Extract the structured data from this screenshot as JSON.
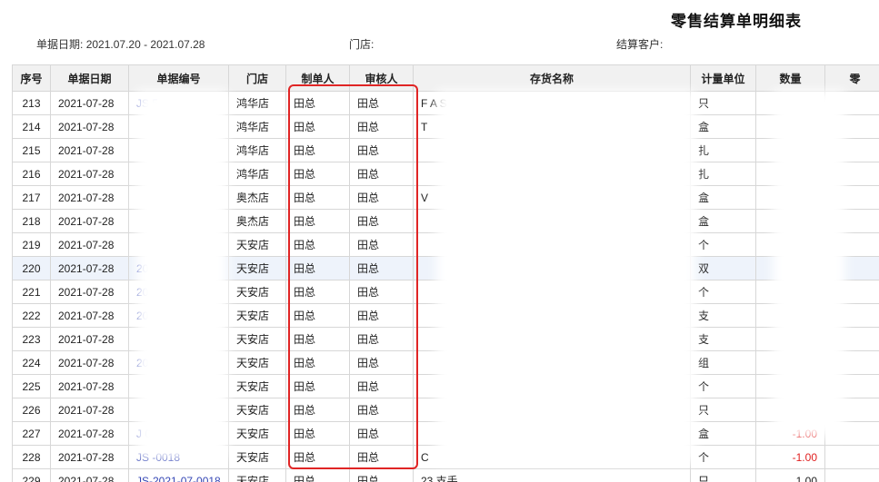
{
  "report": {
    "title": "零售结算单明细表",
    "filters": {
      "date_label": "单据日期:",
      "date_value": "2021.07.20 - 2021.07.28",
      "store_label": "门店:",
      "customer_label": "结算客户:"
    }
  },
  "table": {
    "columns": [
      "序号",
      "单据日期",
      "单据编号",
      "门店",
      "制单人",
      "审核人",
      "存货名称",
      "计量单位",
      "数量",
      "零"
    ],
    "rows": [
      {
        "seq": "213",
        "date": "2021-07-28",
        "doc_no": "JS          5",
        "store": "鸿华店",
        "maker": "田总",
        "auditor": "田总",
        "item": "F                               A S",
        "unit": "只",
        "qty": ""
      },
      {
        "seq": "214",
        "date": "2021-07-28",
        "doc_no": "",
        "store": "鸿华店",
        "maker": "田总",
        "auditor": "田总",
        "item": "T",
        "unit": "盒",
        "qty": ""
      },
      {
        "seq": "215",
        "date": "2021-07-28",
        "doc_no": "",
        "store": "鸿华店",
        "maker": "田总",
        "auditor": "田总",
        "item": "",
        "unit": "扎",
        "qty": ""
      },
      {
        "seq": "216",
        "date": "2021-07-28",
        "doc_no": "",
        "store": "鸿华店",
        "maker": "田总",
        "auditor": "田总",
        "item": "",
        "unit": "扎",
        "qty": ""
      },
      {
        "seq": "217",
        "date": "2021-07-28",
        "doc_no": "",
        "store": "奥杰店",
        "maker": "田总",
        "auditor": "田总",
        "item": "V",
        "unit": "盒",
        "qty": ""
      },
      {
        "seq": "218",
        "date": "2021-07-28",
        "doc_no": "",
        "store": "奥杰店",
        "maker": "田总",
        "auditor": "田总",
        "item": "",
        "unit": "盒",
        "qty": ""
      },
      {
        "seq": "219",
        "date": "2021-07-28",
        "doc_no": "",
        "store": "天安店",
        "maker": "田总",
        "auditor": "田总",
        "item": "",
        "unit": "个",
        "qty": ""
      },
      {
        "seq": "220",
        "date": "2021-07-28",
        "doc_no": "20",
        "store": "天安店",
        "maker": "田总",
        "auditor": "田总",
        "item": "",
        "unit": "双",
        "qty": ""
      },
      {
        "seq": "221",
        "date": "2021-07-28",
        "doc_no": "20",
        "store": "天安店",
        "maker": "田总",
        "auditor": "田总",
        "item": "",
        "unit": "个",
        "qty": ""
      },
      {
        "seq": "222",
        "date": "2021-07-28",
        "doc_no": "20",
        "store": "天安店",
        "maker": "田总",
        "auditor": "田总",
        "item": "",
        "unit": "支",
        "qty": ""
      },
      {
        "seq": "223",
        "date": "2021-07-28",
        "doc_no": "",
        "store": "天安店",
        "maker": "田总",
        "auditor": "田总",
        "item": "",
        "unit": "支",
        "qty": ""
      },
      {
        "seq": "224",
        "date": "2021-07-28",
        "doc_no": "20",
        "store": "天安店",
        "maker": "田总",
        "auditor": "田总",
        "item": "",
        "unit": "组",
        "qty": ""
      },
      {
        "seq": "225",
        "date": "2021-07-28",
        "doc_no": "",
        "store": "天安店",
        "maker": "田总",
        "auditor": "田总",
        "item": "",
        "unit": "个",
        "qty": ""
      },
      {
        "seq": "226",
        "date": "2021-07-28",
        "doc_no": "",
        "store": "天安店",
        "maker": "田总",
        "auditor": "田总",
        "item": "",
        "unit": "只",
        "qty": ""
      },
      {
        "seq": "227",
        "date": "2021-07-28",
        "doc_no": "J            0018",
        "store": "天安店",
        "maker": "田总",
        "auditor": "田总",
        "item": "",
        "unit": "盒",
        "qty": "-1.00"
      },
      {
        "seq": "228",
        "date": "2021-07-28",
        "doc_no": "JS           -0018",
        "store": "天安店",
        "maker": "田总",
        "auditor": "田总",
        "item": "C",
        "unit": "个",
        "qty": "-1.00"
      },
      {
        "seq": "229",
        "date": "2021-07-28",
        "doc_no": "JS-2021-07-0018",
        "store": "天安店",
        "maker": "田总",
        "auditor": "田总",
        "item": "23 支手",
        "unit": "只",
        "qty": "1.00"
      }
    ]
  },
  "highlight_color": "#e02525",
  "negative_color": "#e02020",
  "link_color": "#3547b5"
}
